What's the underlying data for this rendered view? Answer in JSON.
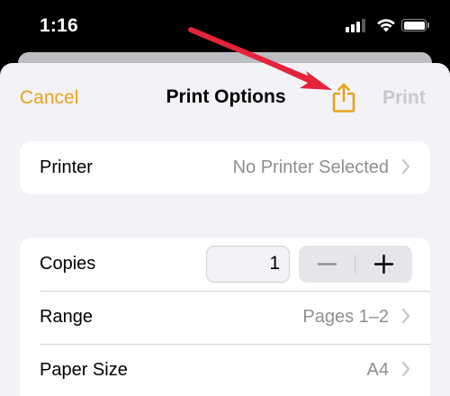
{
  "status_bar": {
    "time": "1:16"
  },
  "nav": {
    "cancel_label": "Cancel",
    "title": "Print Options",
    "share_icon": "share-icon",
    "print_label": "Print"
  },
  "colors": {
    "accent": "#e8a317",
    "disabled": "#c7c7cc",
    "secondary_text": "#8e8e93",
    "annotation_arrow": "#e3243b"
  },
  "printer_group": {
    "printer_label": "Printer",
    "printer_value": "No Printer Selected"
  },
  "options_group": {
    "copies_label": "Copies",
    "copies_value": "1",
    "range_label": "Range",
    "range_value": "Pages 1–2",
    "paper_size_label": "Paper Size",
    "paper_size_value": "A4"
  }
}
